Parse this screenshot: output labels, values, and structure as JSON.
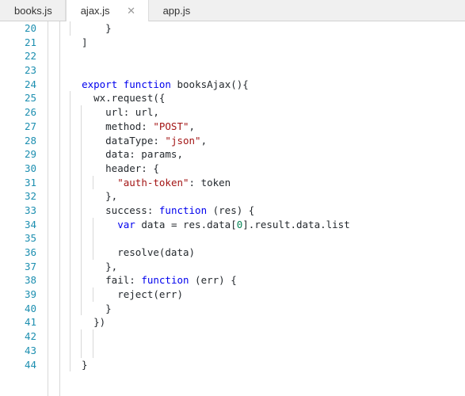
{
  "window": {
    "kind": "code-editor",
    "colors": {
      "tabbar_bg": "#f0f0f0",
      "active_tab_bg": "#ffffff",
      "editor_bg": "#ffffff",
      "lineno": "#1d8fb0",
      "keyword": "#0000ee",
      "string": "#a31515",
      "number": "#098658",
      "text": "#24292e",
      "guide": "#d8d8d8"
    }
  },
  "tabbar": {
    "tabs": [
      {
        "label": "books.js",
        "active": false,
        "closable": false
      },
      {
        "label": "ajax.js",
        "active": true,
        "closable": true,
        "close_glyph": "✕"
      },
      {
        "label": "app.js",
        "active": false,
        "closable": false
      }
    ]
  },
  "editor": {
    "first_line": 20,
    "lines": [
      {
        "n": 20,
        "guides": [
          88
        ],
        "tokens": [
          {
            "t": "      }",
            "c": "pl"
          }
        ]
      },
      {
        "n": 21,
        "guides": [],
        "tokens": [
          {
            "t": "  ]",
            "c": "pl"
          }
        ]
      },
      {
        "n": 22,
        "guides": [],
        "tokens": []
      },
      {
        "n": 23,
        "guides": [],
        "tokens": []
      },
      {
        "n": 24,
        "guides": [],
        "tokens": [
          {
            "t": "  ",
            "c": "pl"
          },
          {
            "t": "export",
            "c": "kw"
          },
          {
            "t": " ",
            "c": "pl"
          },
          {
            "t": "function",
            "c": "kw"
          },
          {
            "t": " booksAjax(){",
            "c": "pl"
          }
        ]
      },
      {
        "n": 25,
        "guides": [
          88
        ],
        "tokens": [
          {
            "t": "    wx.request({",
            "c": "pl"
          }
        ]
      },
      {
        "n": 26,
        "guides": [
          88,
          102
        ],
        "tokens": [
          {
            "t": "      url: url,",
            "c": "pl"
          }
        ]
      },
      {
        "n": 27,
        "guides": [
          88,
          102
        ],
        "tokens": [
          {
            "t": "      method: ",
            "c": "pl"
          },
          {
            "t": "\"POST\"",
            "c": "str"
          },
          {
            "t": ",",
            "c": "pl"
          }
        ]
      },
      {
        "n": 28,
        "guides": [
          88,
          102
        ],
        "tokens": [
          {
            "t": "      dataType: ",
            "c": "pl"
          },
          {
            "t": "\"json\"",
            "c": "str"
          },
          {
            "t": ",",
            "c": "pl"
          }
        ]
      },
      {
        "n": 29,
        "guides": [
          88,
          102
        ],
        "tokens": [
          {
            "t": "      data: params,",
            "c": "pl"
          }
        ]
      },
      {
        "n": 30,
        "guides": [
          88,
          102
        ],
        "tokens": [
          {
            "t": "      header: {",
            "c": "pl"
          }
        ]
      },
      {
        "n": 31,
        "guides": [
          88,
          102,
          117
        ],
        "tokens": [
          {
            "t": "        ",
            "c": "pl"
          },
          {
            "t": "\"auth-token\"",
            "c": "str"
          },
          {
            "t": ": token",
            "c": "pl"
          }
        ]
      },
      {
        "n": 32,
        "guides": [
          88,
          102
        ],
        "tokens": [
          {
            "t": "      },",
            "c": "pl"
          }
        ]
      },
      {
        "n": 33,
        "guides": [
          88,
          102
        ],
        "tokens": [
          {
            "t": "      success: ",
            "c": "pl"
          },
          {
            "t": "function",
            "c": "kw"
          },
          {
            "t": " (res) {",
            "c": "pl"
          }
        ]
      },
      {
        "n": 34,
        "guides": [
          88,
          102,
          117
        ],
        "tokens": [
          {
            "t": "        ",
            "c": "pl"
          },
          {
            "t": "var",
            "c": "kw"
          },
          {
            "t": " data = res.data[",
            "c": "pl"
          },
          {
            "t": "0",
            "c": "num"
          },
          {
            "t": "].result.data.list",
            "c": "pl"
          }
        ]
      },
      {
        "n": 35,
        "guides": [
          88,
          102,
          117
        ],
        "tokens": []
      },
      {
        "n": 36,
        "guides": [
          88,
          102,
          117
        ],
        "tokens": [
          {
            "t": "        resolve(data)",
            "c": "pl"
          }
        ]
      },
      {
        "n": 37,
        "guides": [
          88,
          102
        ],
        "tokens": [
          {
            "t": "      },",
            "c": "pl"
          }
        ]
      },
      {
        "n": 38,
        "guides": [
          88,
          102
        ],
        "tokens": [
          {
            "t": "      fail: ",
            "c": "pl"
          },
          {
            "t": "function",
            "c": "kw"
          },
          {
            "t": " (err) {",
            "c": "pl"
          }
        ]
      },
      {
        "n": 39,
        "guides": [
          88,
          102,
          117
        ],
        "tokens": [
          {
            "t": "        reject(err)",
            "c": "pl"
          }
        ]
      },
      {
        "n": 40,
        "guides": [
          88,
          102
        ],
        "tokens": [
          {
            "t": "      }",
            "c": "pl"
          }
        ]
      },
      {
        "n": 41,
        "guides": [
          88
        ],
        "tokens": [
          {
            "t": "    })",
            "c": "pl"
          }
        ]
      },
      {
        "n": 42,
        "guides": [
          88,
          102,
          117
        ],
        "tokens": []
      },
      {
        "n": 43,
        "guides": [
          88,
          102,
          117
        ],
        "tokens": []
      },
      {
        "n": 44,
        "guides": [
          88
        ],
        "tokens": [
          {
            "t": "  }",
            "c": "pl"
          }
        ]
      }
    ]
  }
}
